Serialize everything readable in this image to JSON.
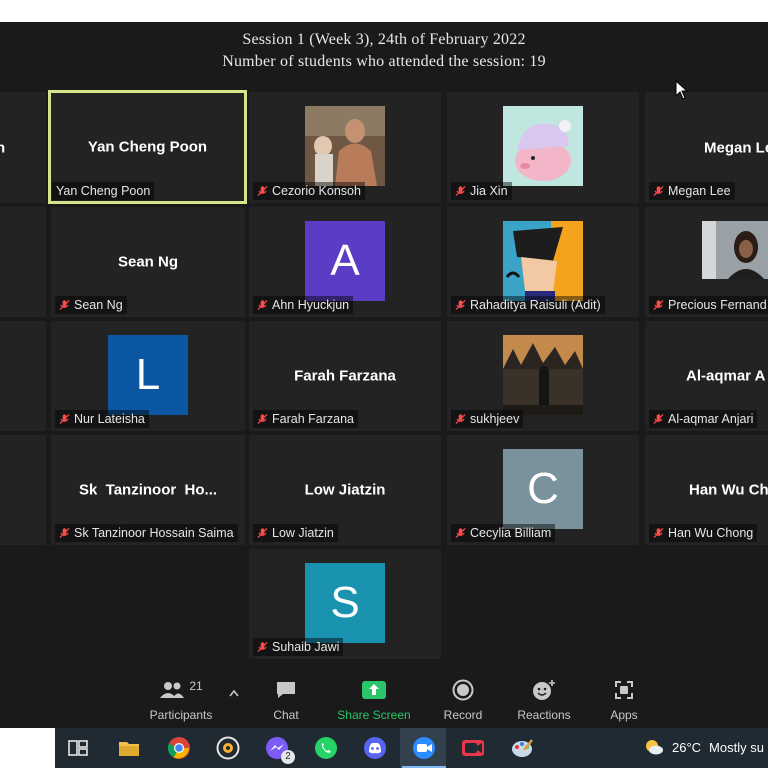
{
  "caption": {
    "line1": "Session 1 (Week 3), 24th of February 2022",
    "line2": "Number of students who attended the session: 19"
  },
  "tiles": {
    "r1c0": {
      "plate": ""
    },
    "r1c1": {
      "center": "Yan Cheng Poon",
      "plate": "Yan Cheng Poon"
    },
    "r1c2": {
      "plate": "Cezorio Konsoh",
      "icon": "photo"
    },
    "r1c3": {
      "plate": "Jia Xin",
      "icon": "kirby-avatar"
    },
    "r1c4": {
      "center": "Megan Le",
      "plate": "Megan Lee"
    },
    "r2c1": {
      "center": "Sean Ng",
      "plate": "Sean Ng"
    },
    "r2c2": {
      "letter": "A",
      "plate": "Ahn Hyuckjun",
      "color": "#5b3cc4"
    },
    "r2c3": {
      "plate": "Rahaditya Raisuli (Adit)",
      "icon": "cartoon-avatar"
    },
    "r2c4": {
      "plate": "Precious Fernand",
      "icon": "photo"
    },
    "r3c1": {
      "letter": "L",
      "plate": "Nur Lateisha",
      "color": "#0b57a4"
    },
    "r3c2": {
      "center": "Farah Farzana",
      "plate": "Farah Farzana"
    },
    "r3c3": {
      "plate": "sukhjeev",
      "icon": "photo"
    },
    "r3c4": {
      "center": "Al-aqmar A",
      "plate": "Al-aqmar Anjari"
    },
    "r4c1": {
      "center": "Sk  Tanzinoor  Ho...",
      "plate": "Sk Tanzinoor Hossain Saima"
    },
    "r4c2": {
      "center": "Low Jiatzin",
      "plate": "Low Jiatzin"
    },
    "r4c3": {
      "letter": "C",
      "plate": "Cecylia Billiam",
      "color": "#7a929c"
    },
    "r4c4": {
      "center": "Han Wu Ch",
      "plate": "Han Wu Chong"
    },
    "r5c2": {
      "letter": "S",
      "plate": "Suhaib Jawi",
      "color": "#1a93b0"
    }
  },
  "toolbar": {
    "participants_label": "Participants",
    "participants_count": "21",
    "chat_label": "Chat",
    "share_label": "Share Screen",
    "record_label": "Record",
    "reactions_label": "Reactions",
    "apps_label": "Apps",
    "accent": "#2ac46a"
  },
  "taskbar": {
    "messenger_badge": "2",
    "temperature": "26°C",
    "weather": "Mostly su"
  }
}
